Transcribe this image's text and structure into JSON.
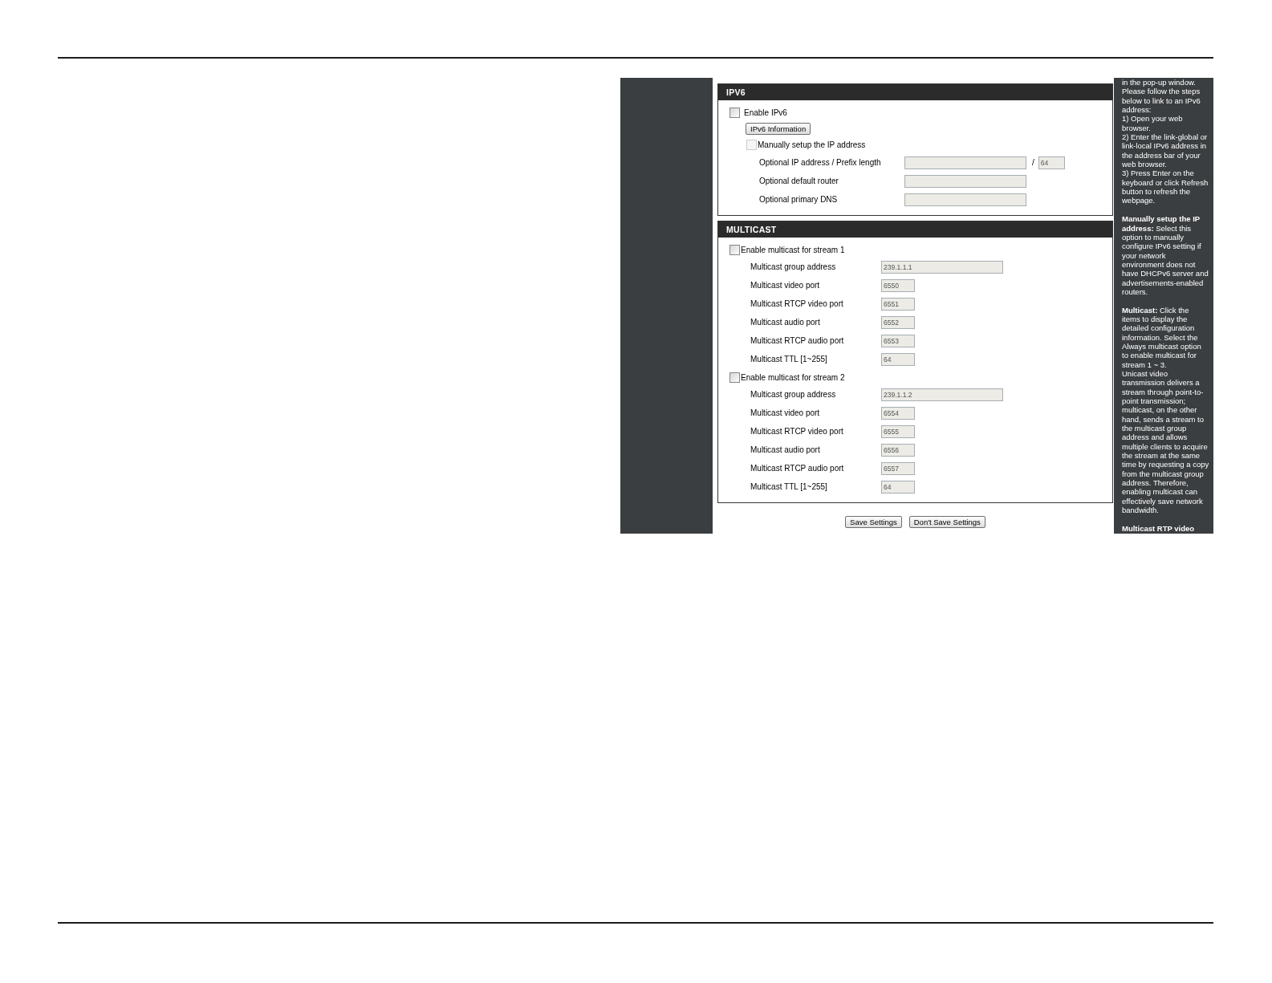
{
  "ipv6": {
    "title": "IPV6",
    "enable": {
      "label": "Enable IPv6",
      "checked": false,
      "disabled": false
    },
    "info_button": "IPv6 Information",
    "manual": {
      "label": "Manually setup the IP address",
      "checked": false,
      "disabled": true
    },
    "fields": [
      {
        "label": "Optional IP address / Prefix length",
        "separator": "/",
        "prefix": "64"
      },
      {
        "label": "Optional default router"
      },
      {
        "label": "Optional primary DNS"
      }
    ]
  },
  "multicast": {
    "title": "MULTICAST",
    "streams": [
      {
        "label": "Enable multicast for stream 1",
        "checked": false,
        "disabled": false,
        "fields": [
          {
            "label": "Multicast group address",
            "value": "239.1.1.1",
            "kind": "address"
          },
          {
            "label": "Multicast video port",
            "value": "6550",
            "kind": "port"
          },
          {
            "label": "Multicast RTCP video port",
            "value": "6551",
            "kind": "port"
          },
          {
            "label": "Multicast audio port",
            "value": "6552",
            "kind": "port"
          },
          {
            "label": "Multicast RTCP audio port",
            "value": "6553",
            "kind": "port"
          },
          {
            "label": "Multicast TTL [1~255]",
            "value": "64",
            "kind": "port"
          }
        ]
      },
      {
        "label": "Enable multicast for stream 2",
        "checked": false,
        "disabled": false,
        "fields": [
          {
            "label": "Multicast group address",
            "value": "239.1.1.2",
            "kind": "address"
          },
          {
            "label": "Multicast video port",
            "value": "6554",
            "kind": "port"
          },
          {
            "label": "Multicast RTCP video port",
            "value": "6555",
            "kind": "port"
          },
          {
            "label": "Multicast audio port",
            "value": "6556",
            "kind": "port"
          },
          {
            "label": "Multicast RTCP audio port",
            "value": "6557",
            "kind": "port"
          },
          {
            "label": "Multicast TTL [1~255]",
            "value": "64",
            "kind": "port"
          }
        ]
      }
    ]
  },
  "buttons": [
    "Save Settings",
    "Don't Save Settings"
  ],
  "help": {
    "paragraphs": [
      {
        "lines": [
          "in the pop-up window.",
          "Please follow the steps",
          "below to link to an IPv6",
          "address:",
          "1) Open your web",
          "browser.",
          "2) Enter the link-global or",
          "link-local IPv6 address in",
          "the address bar of your",
          "web browser.",
          "3) Press Enter on the",
          "keyboard or click Refresh",
          "button to refresh the",
          "webpage."
        ]
      },
      {
        "lines": [
          "**Manually setup the IP**",
          "**address:** Select this",
          "option to manually",
          "configure IPv6 setting if",
          "your network",
          "environment does not",
          "have DHCPv6 server and",
          "advertisements-enabled",
          "routers."
        ]
      },
      {
        "lines": [
          "**Multicast:** Click the",
          "items to display the",
          "detailed configuration",
          "information. Select the",
          "Always multicast option",
          "to enable multicast for",
          "stream 1 ~ 3.",
          "Unicast video",
          "transmission delivers a",
          "stream through point-to-",
          "point transmission;",
          "multicast, on the other",
          "hand, sends a stream to",
          "the multicast group",
          "address and allows",
          "multiple clients to acquire",
          "the stream at the same",
          "time by requesting a copy",
          "from the multicast group",
          "address. Therefore,",
          "enabling multicast can",
          "effectively save network",
          "bandwidth."
        ]
      },
      {
        "lines": [
          "**Multicast RTP video**"
        ]
      }
    ]
  }
}
